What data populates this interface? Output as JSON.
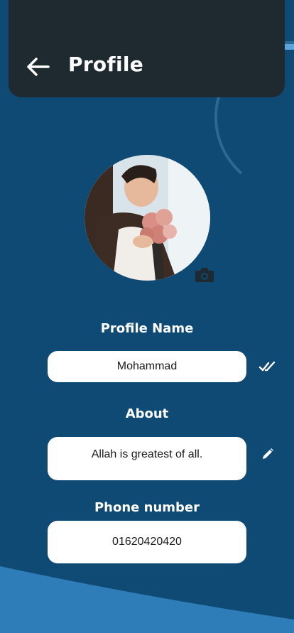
{
  "header": {
    "title": "Profile",
    "back_icon": "arrow-left-icon"
  },
  "profile": {
    "avatar_alt": "profile-photo",
    "camera_icon": "camera-icon"
  },
  "fields": {
    "name_label": "Profile Name",
    "name_value": "Mohammad",
    "name_action_icon": "double-check-icon",
    "about_label": "About",
    "about_value": "Allah is greatest of all.",
    "about_action_icon": "pencil-icon",
    "phone_label": "Phone number",
    "phone_value": "01620420420"
  },
  "colors": {
    "background": "#0f4a74",
    "header": "#1e2a30",
    "wave": "#2e7cb8",
    "field_bg": "#ffffff"
  }
}
